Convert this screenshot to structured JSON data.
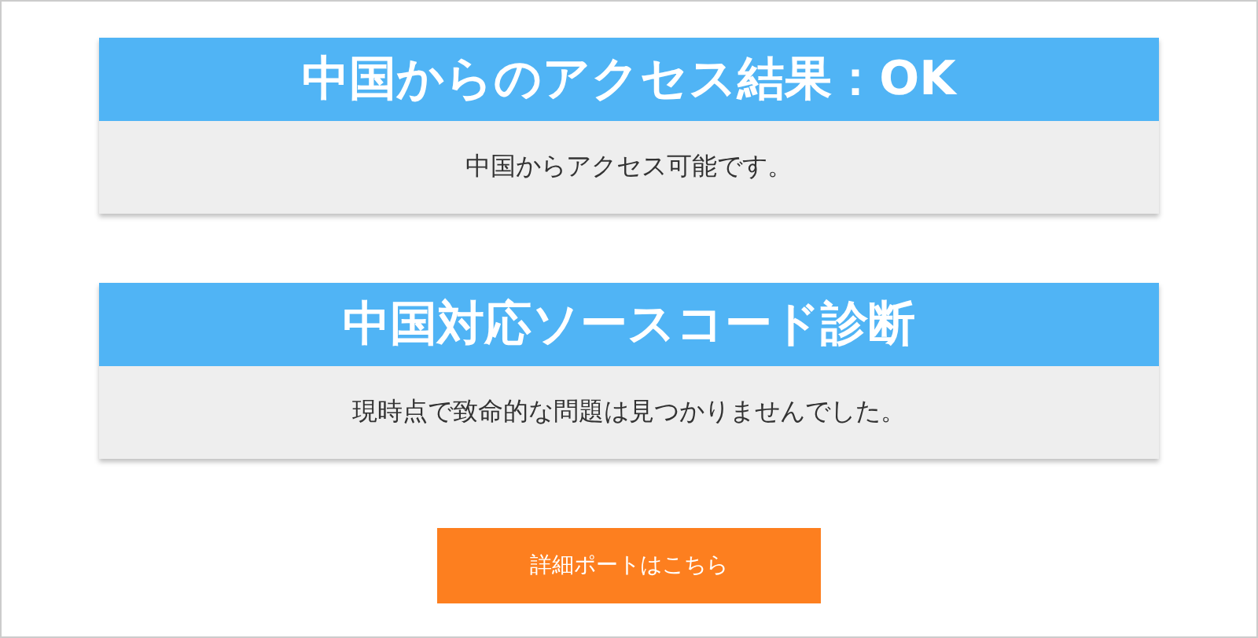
{
  "result_cards": [
    {
      "title": "中国からのアクセス結果：OK",
      "message": "中国からアクセス可能です。"
    },
    {
      "title": "中国対応ソースコード診断",
      "message": "現時点で致命的な問題は見つかりませんでした。"
    }
  ],
  "report_button": {
    "label": "詳細ポートはこちら"
  }
}
